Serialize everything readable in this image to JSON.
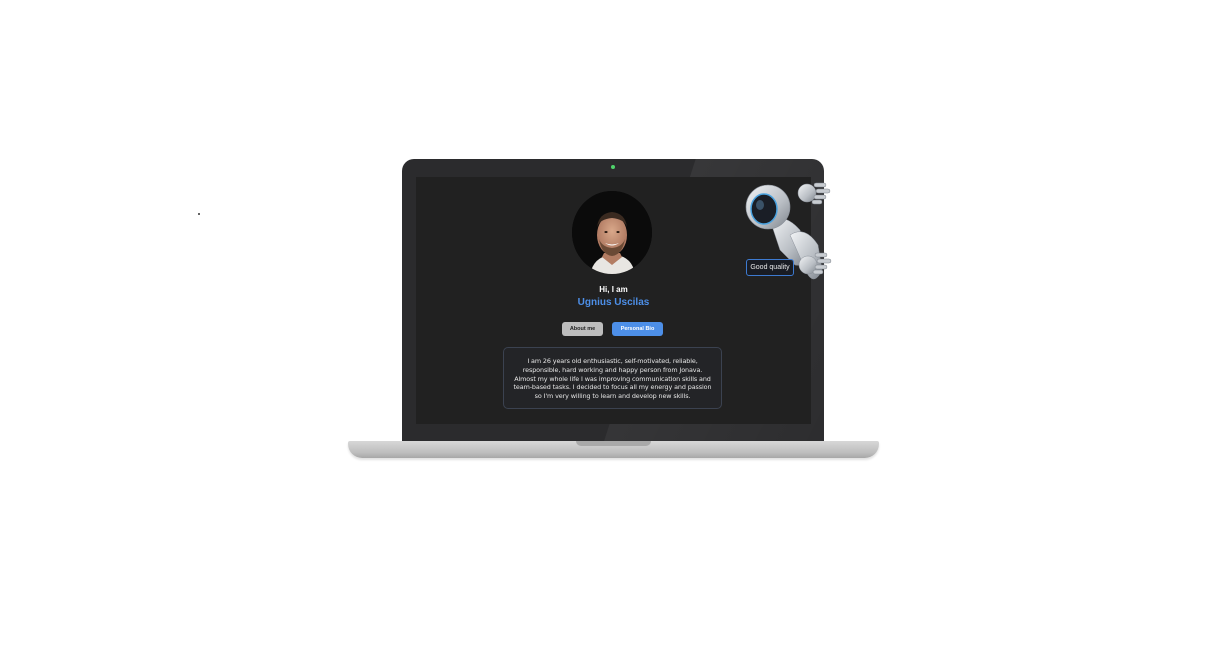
{
  "hero": {
    "greeting": "Hi, I am",
    "name": "Ugnius Uscilas"
  },
  "buttons": {
    "about_label": "About me",
    "bio_label": "Personal Bio"
  },
  "bio": {
    "text": "I am 26 years old enthusiastic, self-motivated, reliable, responsible, hard working and happy person from Jonava. Almost my whole life I was improving communication skills and team-based tasks. I decided to focus all my energy and passion so I'm very willing to learn and develop new skills."
  },
  "robot": {
    "badge_text": "Good quality"
  },
  "colors": {
    "accent": "#4d8fe8",
    "screen_bg": "#212121",
    "lid": "#2b2b2d",
    "camera_led": "#4fd36b"
  }
}
